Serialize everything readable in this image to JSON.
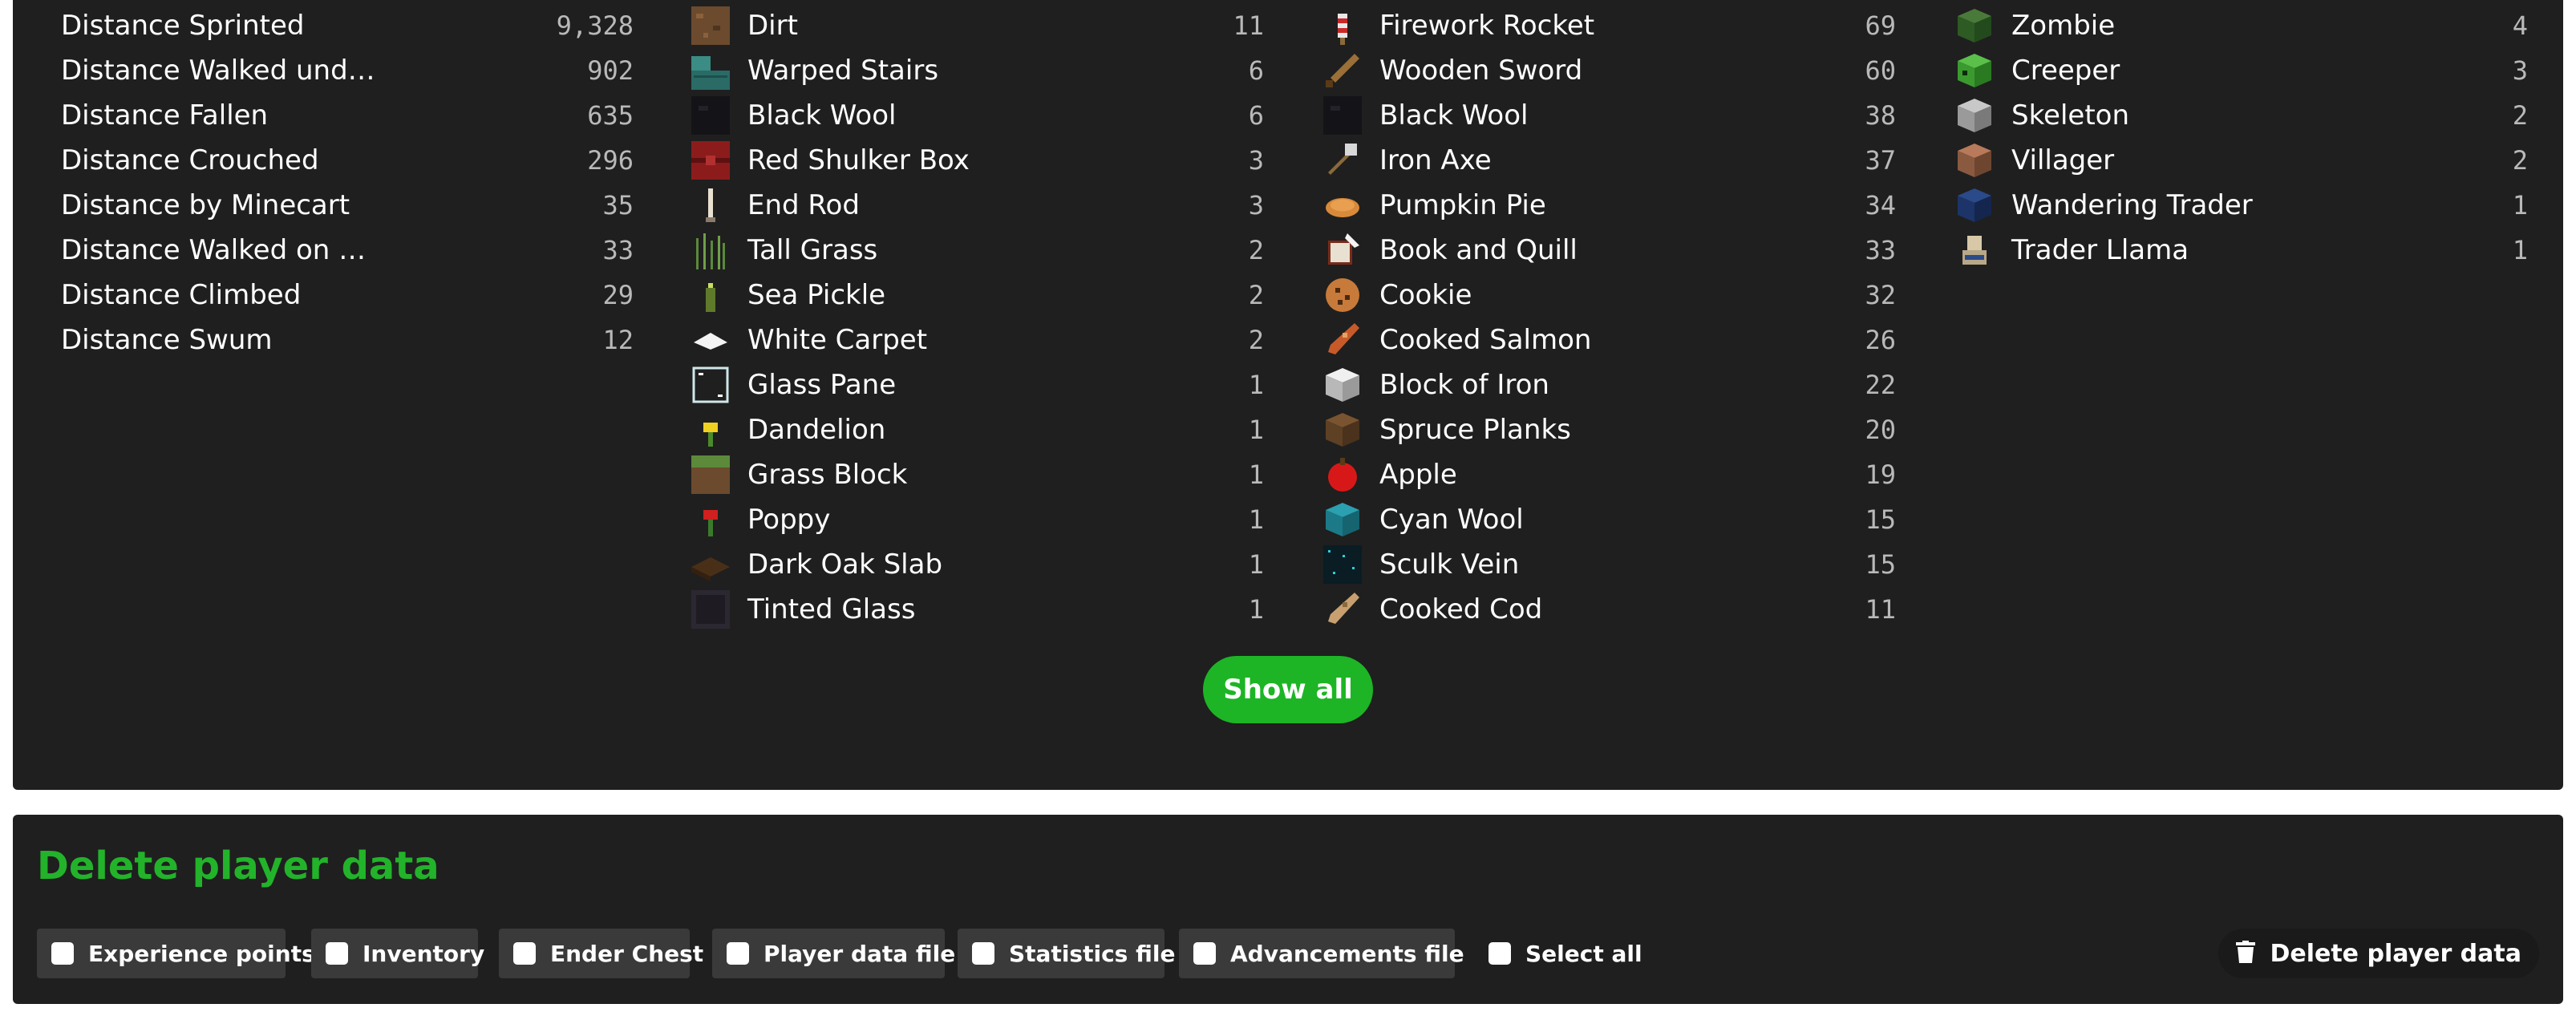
{
  "distance_stats": [
    {
      "label": "Distance Sprinted",
      "value": "9,328"
    },
    {
      "label": "Distance Walked und…",
      "value": "902"
    },
    {
      "label": "Distance Fallen",
      "value": "635"
    },
    {
      "label": "Distance Crouched",
      "value": "296"
    },
    {
      "label": "Distance by Minecart",
      "value": "35"
    },
    {
      "label": "Distance Walked on …",
      "value": "33"
    },
    {
      "label": "Distance Climbed",
      "value": "29"
    },
    {
      "label": "Distance Swum",
      "value": "12"
    }
  ],
  "blocks": [
    {
      "label": "Dirt",
      "value": "11",
      "icon": "dirt-icon"
    },
    {
      "label": "Warped Stairs",
      "value": "6",
      "icon": "warped-stairs-icon"
    },
    {
      "label": "Black Wool",
      "value": "6",
      "icon": "black-wool-icon"
    },
    {
      "label": "Red Shulker Box",
      "value": "3",
      "icon": "red-shulker-box-icon"
    },
    {
      "label": "End Rod",
      "value": "3",
      "icon": "end-rod-icon"
    },
    {
      "label": "Tall Grass",
      "value": "2",
      "icon": "tall-grass-icon"
    },
    {
      "label": "Sea Pickle",
      "value": "2",
      "icon": "sea-pickle-icon"
    },
    {
      "label": "White Carpet",
      "value": "2",
      "icon": "white-carpet-icon"
    },
    {
      "label": "Glass Pane",
      "value": "1",
      "icon": "glass-pane-icon"
    },
    {
      "label": "Dandelion",
      "value": "1",
      "icon": "dandelion-icon"
    },
    {
      "label": "Grass Block",
      "value": "1",
      "icon": "grass-block-icon"
    },
    {
      "label": "Poppy",
      "value": "1",
      "icon": "poppy-icon"
    },
    {
      "label": "Dark Oak Slab",
      "value": "1",
      "icon": "dark-oak-slab-icon"
    },
    {
      "label": "Tinted Glass",
      "value": "1",
      "icon": "tinted-glass-icon"
    }
  ],
  "items": [
    {
      "label": "Firework Rocket",
      "value": "69",
      "icon": "firework-rocket-icon"
    },
    {
      "label": "Wooden Sword",
      "value": "60",
      "icon": "wooden-sword-icon"
    },
    {
      "label": "Black Wool",
      "value": "38",
      "icon": "black-wool-icon"
    },
    {
      "label": "Iron Axe",
      "value": "37",
      "icon": "iron-axe-icon"
    },
    {
      "label": "Pumpkin Pie",
      "value": "34",
      "icon": "pumpkin-pie-icon"
    },
    {
      "label": "Book and Quill",
      "value": "33",
      "icon": "book-and-quill-icon"
    },
    {
      "label": "Cookie",
      "value": "32",
      "icon": "cookie-icon"
    },
    {
      "label": "Cooked Salmon",
      "value": "26",
      "icon": "cooked-salmon-icon"
    },
    {
      "label": "Block of Iron",
      "value": "22",
      "icon": "iron-block-icon"
    },
    {
      "label": "Spruce Planks",
      "value": "20",
      "icon": "spruce-planks-icon"
    },
    {
      "label": "Apple",
      "value": "19",
      "icon": "apple-icon"
    },
    {
      "label": "Cyan Wool",
      "value": "15",
      "icon": "cyan-wool-icon"
    },
    {
      "label": "Sculk Vein",
      "value": "15",
      "icon": "sculk-vein-icon"
    },
    {
      "label": "Cooked Cod",
      "value": "11",
      "icon": "cooked-cod-icon"
    }
  ],
  "mobs": [
    {
      "label": "Zombie",
      "value": "4",
      "icon": "zombie-icon"
    },
    {
      "label": "Creeper",
      "value": "3",
      "icon": "creeper-icon"
    },
    {
      "label": "Skeleton",
      "value": "2",
      "icon": "skeleton-icon"
    },
    {
      "label": "Villager",
      "value": "2",
      "icon": "villager-icon"
    },
    {
      "label": "Wandering Trader",
      "value": "1",
      "icon": "wandering-trader-icon"
    },
    {
      "label": "Trader Llama",
      "value": "1",
      "icon": "trader-llama-icon"
    }
  ],
  "show_all_label": "Show all",
  "delete_section": {
    "title": "Delete player data",
    "options": [
      "Experience points",
      "Inventory",
      "Ender Chest",
      "Player data file",
      "Statistics file",
      "Advancements file"
    ],
    "select_all_label": "Select all",
    "delete_button_label": "Delete player data",
    "delete_icon": "trash-icon"
  },
  "colors": {
    "accent": "#1db525",
    "panel": "#1f1f1f",
    "chip": "#3a3a3a",
    "value_text": "#b9b9b9"
  }
}
